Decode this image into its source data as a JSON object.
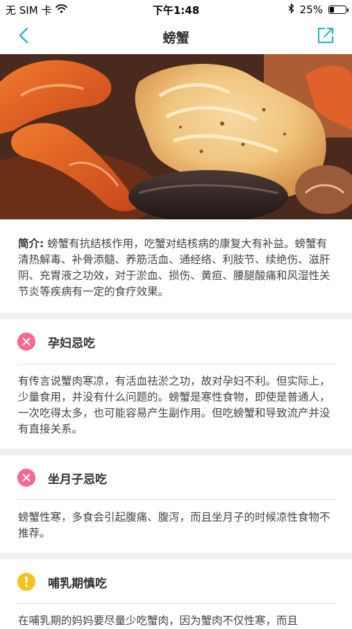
{
  "status_bar": {
    "carrier": "无 SIM 卡",
    "time": "下午1:48",
    "battery_percent": "25%",
    "battery_level": 0.25
  },
  "nav": {
    "title": "螃蟹"
  },
  "intro": {
    "label": "简介:",
    "text": "螃蟹有抗结核作用，吃蟹对结核病的康复大有补益。螃蟹有清热解毒、补骨添髓、养筋活血、通经络、利肢节、续绝伤、滋肝阴、充胃液之功效，对于淤血、损伤、黄疸、腰腿酸痛和风湿性关节炎等疾病有一定的食疗效果。"
  },
  "sections": [
    {
      "title": "孕妇忌吃",
      "icon": "x-circle-icon",
      "text": "有传言说蟹肉寒凉，有活血祛淤之功，故对孕妇不利。但实际上，少量食用，并没有什么问题的。螃蟹是寒性食物，即使是普通人，一次吃得太多，也可能容易产生副作用。但吃螃蟹和导致流产并没有直接关系。"
    },
    {
      "title": "坐月子忌吃",
      "icon": "x-circle-icon",
      "text": "螃蟹性寒，多食会引起腹痛、腹泻，而且坐月子的时候凉性食物不推荐。"
    },
    {
      "title": "哺乳期慎吃",
      "icon": "exclamation-circle-icon",
      "text": "在哺乳期的妈妈要尽量少吃蟹肉，因为蟹肉不仅性寒，而且"
    }
  ],
  "colors": {
    "accent": "#2fb6c9",
    "avoid_badge": "#f5698f",
    "caution_badge": "#f6c21b",
    "section_gap": "#efefef"
  }
}
